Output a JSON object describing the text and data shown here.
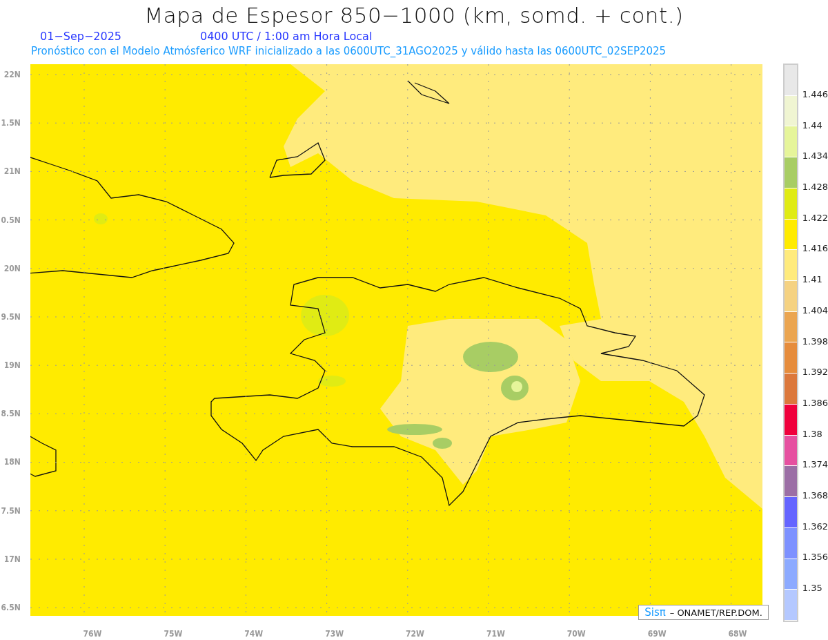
{
  "title": "Mapa de Espesor 850−1000 (km, somd. + cont.)",
  "subtitle": {
    "date": "01−Sep−2025",
    "time": "0400 UTC / 1:00 am Hora Local"
  },
  "description": "Pronóstico con el Modelo Atmósferico WRF inicializado a las 0600UTC_31AGO2025 y válido hasta las  0600UTC_02SEP2025",
  "y_axis": [
    "22N",
    "1.5N",
    "21N",
    "0.5N",
    "20N",
    "9.5N",
    "19N",
    "8.5N",
    "18N",
    "7.5N",
    "17N",
    "6.5N"
  ],
  "x_axis": [
    "76W",
    "75W",
    "74W",
    "73W",
    "72W",
    "71W",
    "70W",
    "69W",
    "68W"
  ],
  "credit": {
    "brand": "Sisπ",
    "text": "– ONAMET/REP.DOM."
  },
  "legend": {
    "bins": [
      {
        "color": "#e8e8e8"
      },
      {
        "color": "#f0f5d2"
      },
      {
        "color": "#e6f59a"
      },
      {
        "color": "#a8cd64"
      },
      {
        "color": "#e0eb14"
      },
      {
        "color": "#ffeb00"
      },
      {
        "color": "#ffeb7d"
      },
      {
        "color": "#f5d282"
      },
      {
        "color": "#eba550"
      },
      {
        "color": "#e68c3c"
      },
      {
        "color": "#dc783c"
      },
      {
        "color": "#f0003c"
      },
      {
        "color": "#e650a0"
      },
      {
        "color": "#9b6ea5"
      },
      {
        "color": "#6464ff"
      },
      {
        "color": "#7d91ff"
      },
      {
        "color": "#8caaff"
      },
      {
        "color": "#b4c8ff"
      }
    ],
    "labels": [
      "1.446",
      "1.44",
      "1.434",
      "1.428",
      "1.422",
      "1.416",
      "1.41",
      "1.404",
      "1.398",
      "1.392",
      "1.386",
      "1.38",
      "1.374",
      "1.368",
      "1.362",
      "1.356",
      "1.35"
    ]
  }
}
